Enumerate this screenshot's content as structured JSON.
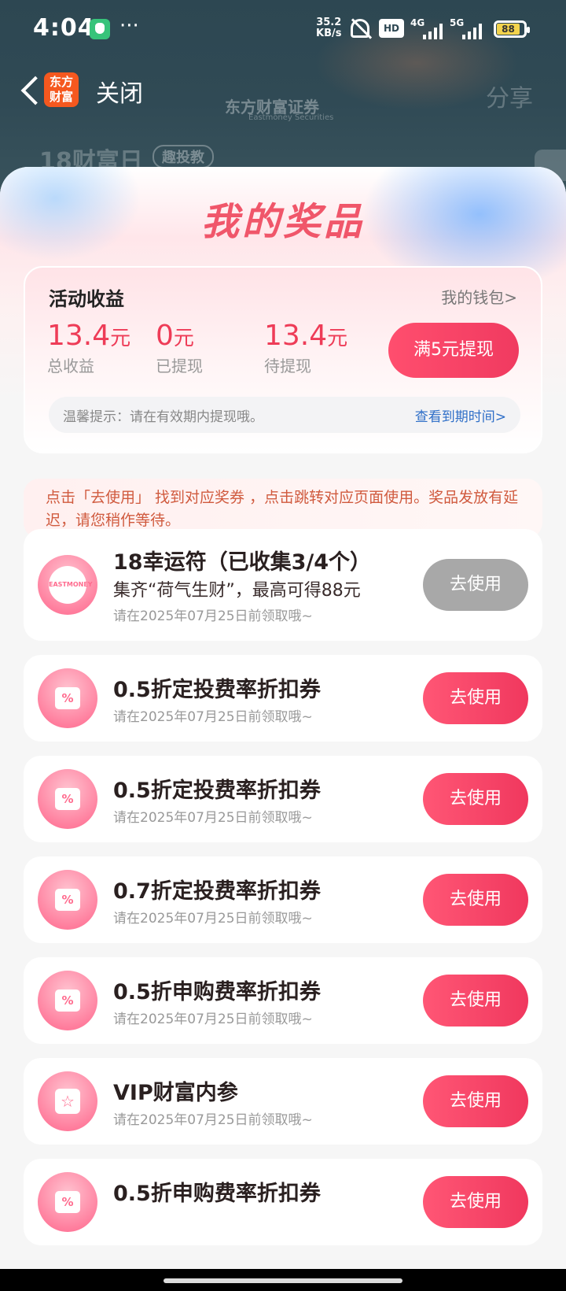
{
  "status_bar": {
    "time": "4:04",
    "net_speed": "35.2",
    "net_unit": "KB/s",
    "hd_label": "HD",
    "sig1_label": "4G",
    "sig2_label": "5G",
    "battery": "88"
  },
  "nav": {
    "logo_text": "东方财富",
    "close_label": "关闭",
    "brand_text": "东方财富证券",
    "brand_sub": "Eastmoney Securities",
    "share_label": "分享",
    "bg_title": "18财富日",
    "bg_tag": "趣投教"
  },
  "sheet": {
    "title": "我的奖品"
  },
  "earnings": {
    "title": "活动收益",
    "wallet_link": "我的钱包>",
    "total_value": "13.4",
    "total_unit": "元",
    "total_label": "总收益",
    "withdrawn_value": "0",
    "withdrawn_unit": "元",
    "withdrawn_label": "已提现",
    "pending_value": "13.4",
    "pending_unit": "元",
    "pending_label": "待提现",
    "withdraw_button": "满5元提现",
    "tip_text": "温馨提示：请在有效期内提现哦。",
    "tip_link": "查看到期时间>"
  },
  "notice": "点击「去使用」 找到对应奖券 ，点击跳转对应页面使用。奖品发放有延迟，请您稍作等待。",
  "prizes": [
    {
      "name": "18幸运符（已收集3/4个）",
      "sub": "集齐“荷气生财”，最高可得88元",
      "expiry": "请在2025年07月25日前领取哦~",
      "button": "去使用",
      "icon": "badge-icon",
      "badge_text": "EASTMONEY"
    },
    {
      "name": "0.5折定投费率折扣券",
      "expiry": "请在2025年07月25日前领取哦~",
      "button": "去使用",
      "icon": "coupon-icon"
    },
    {
      "name": "0.5折定投费率折扣券",
      "expiry": "请在2025年07月25日前领取哦~",
      "button": "去使用",
      "icon": "coupon-icon"
    },
    {
      "name": "0.7折定投费率折扣券",
      "expiry": "请在2025年07月25日前领取哦~",
      "button": "去使用",
      "icon": "coupon-icon"
    },
    {
      "name": "0.5折申购费率折扣券",
      "expiry": "请在2025年07月25日前领取哦~",
      "button": "去使用",
      "icon": "coupon-icon"
    },
    {
      "name": "VIP财富内参",
      "expiry": "请在2025年07月25日前领取哦~",
      "button": "去使用",
      "icon": "star-icon"
    },
    {
      "name": "0.5折申购费率折扣券",
      "button": "去使用",
      "icon": "coupon-icon"
    }
  ],
  "icons": {
    "coupon_glyph": "%",
    "star_glyph": "☆"
  },
  "colors": {
    "accent": "#f03a60",
    "title": "#f0566a",
    "link": "#2f6fc8",
    "disabled": "#a8a8a8"
  }
}
